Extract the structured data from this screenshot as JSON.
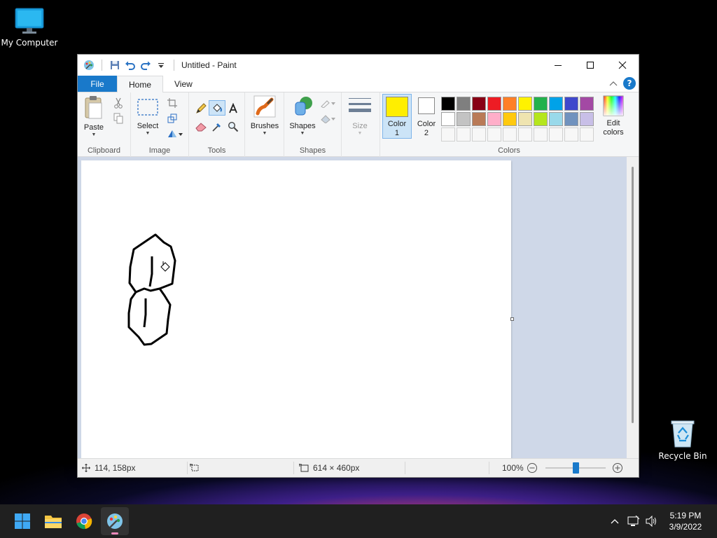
{
  "desktop": {
    "icons": [
      {
        "label": "My Computer"
      },
      {
        "label": "Recycle Bin"
      }
    ]
  },
  "window": {
    "title": "Untitled - Paint"
  },
  "tabs": {
    "file": "File",
    "home": "Home",
    "view": "View"
  },
  "ribbon": {
    "clipboard": {
      "paste": "Paste",
      "label": "Clipboard"
    },
    "image": {
      "select": "Select",
      "label": "Image"
    },
    "tools": {
      "label": "Tools"
    },
    "brushes": {
      "label": "Brushes"
    },
    "shapes": {
      "label": "Shapes",
      "group_label": "Shapes"
    },
    "size": {
      "label": "Size"
    },
    "colors": {
      "color1_line1": "Color",
      "color1_line2": "1",
      "color2_line1": "Color",
      "color2_line2": "2",
      "edit_line1": "Edit",
      "edit_line2": "colors",
      "label": "Colors",
      "color1_value": "#ffee00",
      "color2_value": "#ffffff",
      "palette_row1": [
        "#000000",
        "#7f7f7f",
        "#880015",
        "#ed1c24",
        "#ff7f27",
        "#fff200",
        "#22b14c",
        "#00a2e8",
        "#3f48cc",
        "#a349a4"
      ],
      "palette_row2": [
        "#ffffff",
        "#c3c3c3",
        "#b97a57",
        "#ffaec9",
        "#ffc90e",
        "#efe4b0",
        "#b5e61d",
        "#99d9ea",
        "#7092be",
        "#c8bfe7"
      ]
    }
  },
  "statusbar": {
    "cursor_position": "114, 158px",
    "selection_size": "",
    "canvas_size": "614 × 460px",
    "zoom": "100%",
    "zoom_fraction": 0.5
  },
  "taskbar": {
    "time": "5:19 PM",
    "date": "3/9/2022"
  }
}
